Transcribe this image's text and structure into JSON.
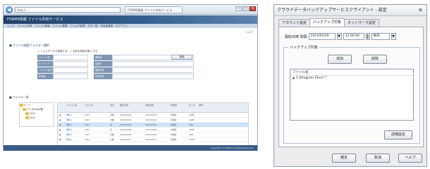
{
  "browser": {
    "address": "http://...",
    "tab_title": "FORMS情報 ファイル共有サービス",
    "controls": [
      "─",
      "□",
      "✕"
    ]
  },
  "web": {
    "banner": "FORMS情報 ファイル共有サービス",
    "nav": [
      "トップ",
      "ファイル共有",
      "ファイル検索",
      "ファイル履歴",
      "フォルダ管理",
      "ログ一覧",
      "利用者管理",
      "ログアウト"
    ],
    "help": "ヘルプ",
    "search_title": "■ ファイル検索フォルダー選択",
    "radio": [
      "○ フォルダーから検索する",
      "○ 全体を検索対象とする"
    ],
    "form": [
      {
        "label": "ファイル名",
        "value": "",
        "label2": "更新者",
        "value2": ""
      },
      {
        "label": "キーワード",
        "value": "",
        "label2": "拡張子",
        "value2": ""
      },
      {
        "label": "ファイル区分",
        "value": "",
        "label2": "更新日時",
        "value2": ""
      },
      {
        "label": "作成者",
        "value": "",
        "label2": "作成日時",
        "value2": ""
      }
    ],
    "search_button": "検索",
    "section2": "■ ファイル一覧",
    "tree": [
      "ルート",
      "データ(Excel等)",
      "2013",
      "2012"
    ],
    "table_headers": [
      "",
      "ファイル名",
      "フォルダ",
      "区分",
      "更新日時",
      "作成日時",
      "作成者",
      "サイズ",
      "備考"
    ],
    "rows": [
      {
        "icon": "▣",
        "name": "資料 1",
        "folder": "2013",
        "kind": "文書",
        "updated": "2013/05/29",
        "created": "2013/05/29",
        "author": "管理者",
        "size": "10KB",
        "note": "",
        "selected": false
      },
      {
        "icon": "▣",
        "name": "資料 2",
        "folder": "2013",
        "kind": "文書",
        "updated": "2013/05/29",
        "created": "2013/05/29",
        "author": "管理者",
        "size": "12KB",
        "note": "",
        "selected": false
      },
      {
        "icon": "▣",
        "name": "資料 3",
        "folder": "2013",
        "kind": "表",
        "updated": "2013/05/29",
        "created": "2013/05/29",
        "author": "管理者",
        "size": "8KB",
        "note": "",
        "selected": true
      },
      {
        "icon": "▣",
        "name": "資料 4",
        "folder": "2012",
        "kind": "表",
        "updated": "2013/05/28",
        "created": "2013/05/28",
        "author": "管理者",
        "size": "15KB",
        "note": "",
        "selected": false
      },
      {
        "icon": "▣",
        "name": "資料 5",
        "folder": "2012",
        "kind": "文書",
        "updated": "2013/05/28",
        "created": "2013/05/28",
        "author": "管理者",
        "size": "9KB",
        "note": "",
        "selected": false
      },
      {
        "icon": "▣",
        "name": "資料 6",
        "folder": "2012",
        "kind": "文書",
        "updated": "2013/05/27",
        "created": "2013/05/27",
        "author": "管理者",
        "size": "11KB",
        "note": "",
        "selected": false
      }
    ],
    "footer": "Copyright © FORMS All Rights Reserved."
  },
  "dialog": {
    "title": "クラウドデータバックアップサービスクライアント - 設定",
    "close": "✕",
    "tabs": [
      "アカウント設定",
      "バックアップ対象",
      "ネットワーク設定"
    ],
    "active_tab": 1,
    "start_label": "開始日時 間隔",
    "date": "2013/05/29",
    "time": "12:00:00",
    "frequency": "毎日",
    "dd": "▼",
    "group_label": "バックアップ対象",
    "add_button": "追加",
    "delete_button": "削除",
    "list_header": "ファイル名",
    "list_items": [
      "C:\\Program Files\\*.*"
    ],
    "detail_button": "詳細設定",
    "ok_button": "確定",
    "cancel_button": "取消",
    "help_button": "ヘルプ"
  }
}
